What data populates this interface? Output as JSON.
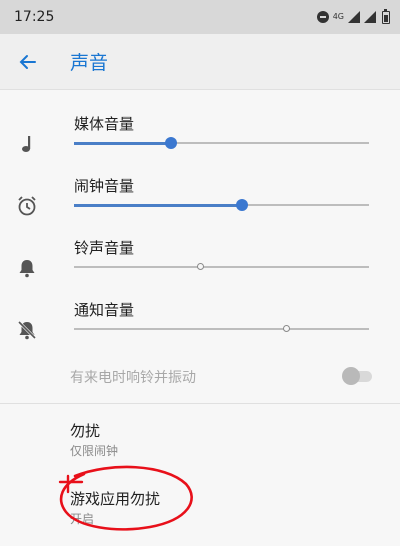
{
  "status_bar": {
    "time": "17:25",
    "network": "4G"
  },
  "app_bar": {
    "title": "声音"
  },
  "sliders": [
    {
      "label": "媒体音量",
      "icon": "music-note-icon",
      "level": 0.33
    },
    {
      "label": "闹钟音量",
      "icon": "alarm-clock-icon",
      "level": 0.57
    },
    {
      "label": "铃声音量",
      "icon": "bell-icon",
      "level": 0.43
    },
    {
      "label": "通知音量",
      "icon": "bell-off-icon",
      "level": 0.72
    }
  ],
  "vibrate": {
    "label": "有来电时响铃并振动",
    "enabled": false
  },
  "items": [
    {
      "title": "勿扰",
      "subtitle": "仅限闹钟"
    },
    {
      "title": "游戏应用勿扰",
      "subtitle": "开启"
    }
  ],
  "colors": {
    "accent": "#1976d2",
    "slider_fill": "#4a7fc7",
    "annotation": "#e8101a"
  }
}
